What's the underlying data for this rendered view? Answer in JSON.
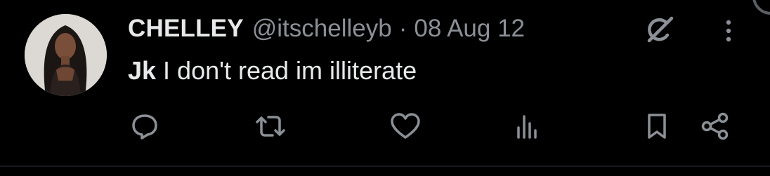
{
  "tweet": {
    "display_name": "CHELLEY",
    "handle": "@itschelleyb",
    "separator": "·",
    "date": "08 Aug 12",
    "text_bold": "Jk",
    "text_rest": " I don't read im illiterate"
  },
  "icons": {
    "grok": "grok-icon",
    "more": "more-vertical-icon",
    "reply": "reply-icon",
    "retweet": "retweet-icon",
    "like": "heart-icon",
    "views": "views-bar-chart-icon",
    "bookmark": "bookmark-icon",
    "share": "share-icon"
  },
  "colors": {
    "background": "#000000",
    "primary_text": "#e7e9ea",
    "secondary_text": "#8b9096",
    "icon": "#8b9096"
  }
}
